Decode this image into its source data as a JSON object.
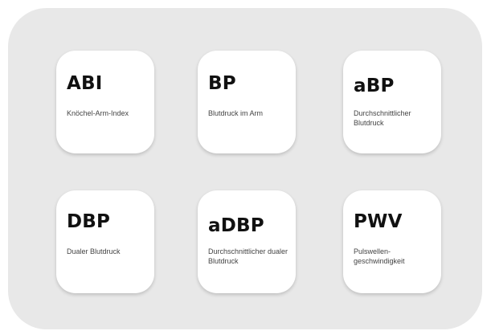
{
  "tiles": [
    {
      "abbr": "ABI",
      "desc": "Knöchel-Arm-Index"
    },
    {
      "abbr": "BP",
      "desc": "Blutdruck im Arm"
    },
    {
      "abbr": "aBP",
      "desc": "Durchschnittlicher Blutdruck"
    },
    {
      "abbr": "DBP",
      "desc": "Dualer Blutdruck"
    },
    {
      "abbr": "aDBP",
      "desc": "Durchschnittlicher dualer Blutdruck"
    },
    {
      "abbr": "PWV",
      "desc": "Pulswellen-\ngeschwindigkeit"
    }
  ]
}
